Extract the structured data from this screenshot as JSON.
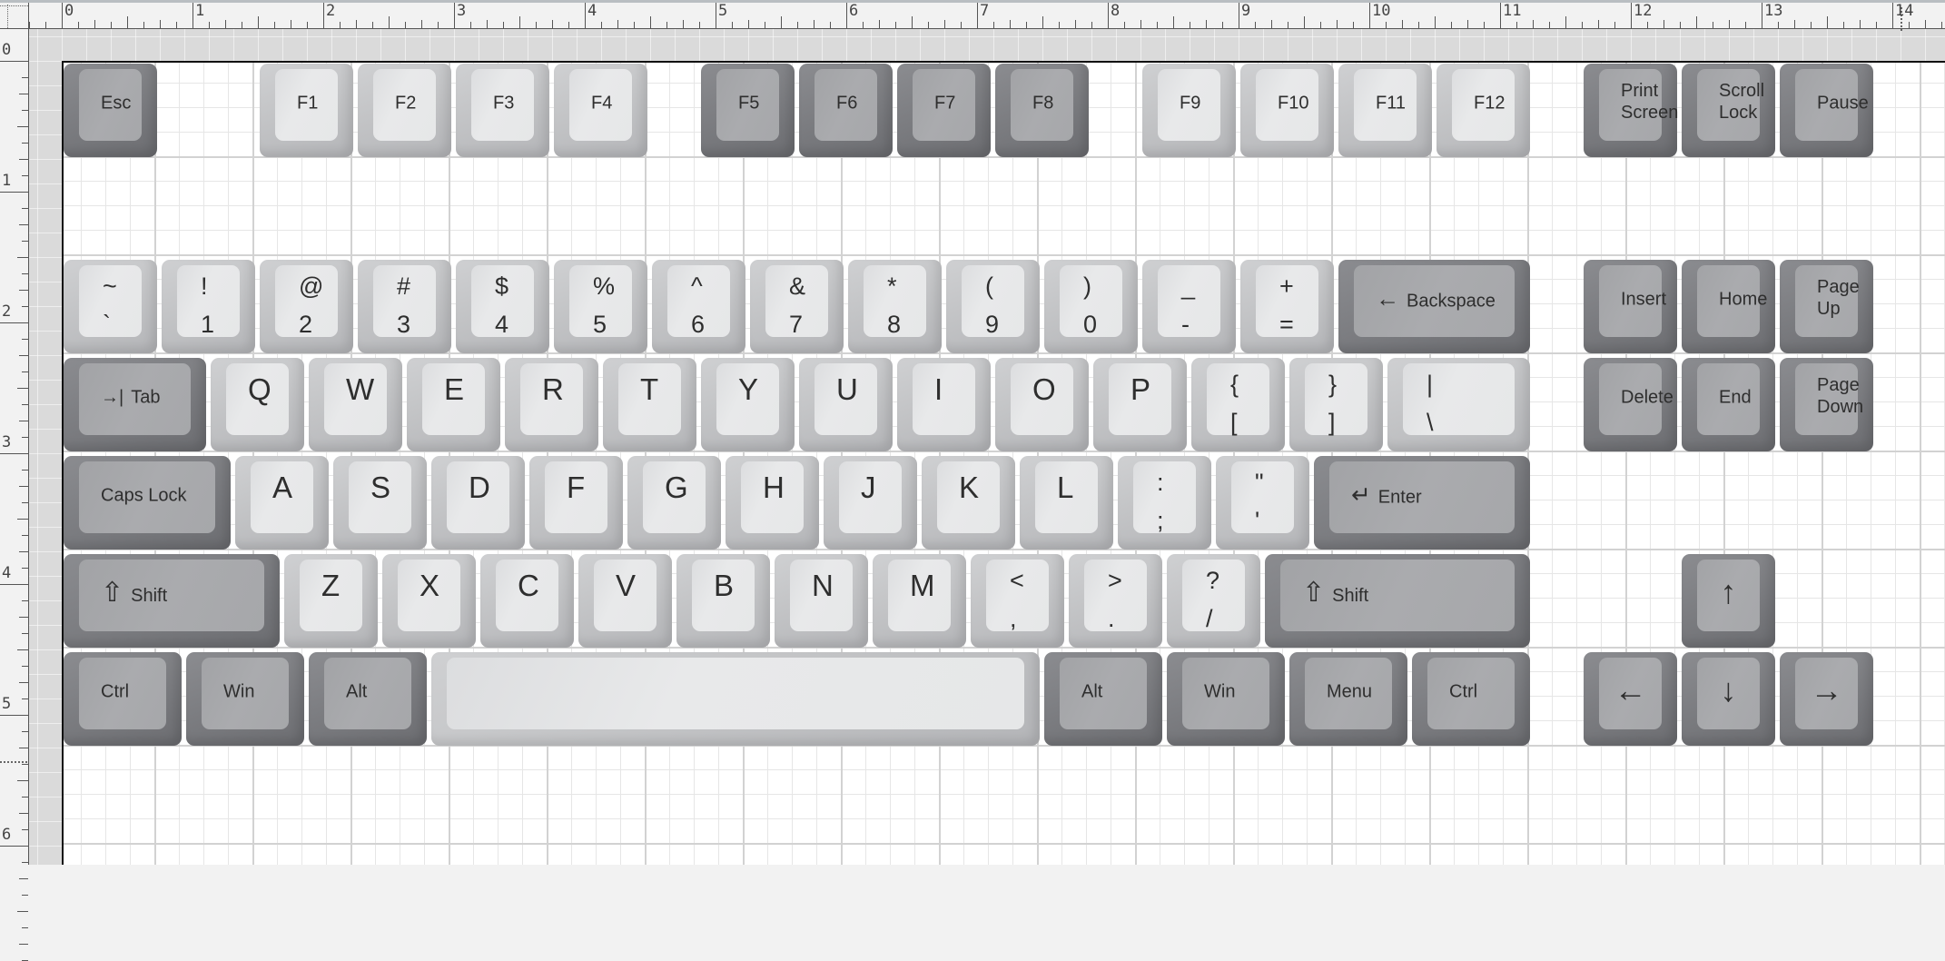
{
  "ruler": {
    "horizontal_labels": [
      "0",
      "1",
      "2",
      "3",
      "4",
      "5",
      "6",
      "7",
      "8",
      "9",
      "10",
      "11",
      "12",
      "13",
      "14"
    ],
    "vertical_labels": [
      "0",
      "1",
      "2",
      "3",
      "4",
      "5",
      "6"
    ]
  },
  "keyboard": {
    "keys": [
      {
        "id": "esc",
        "label": "Esc",
        "row": 0,
        "col": 0,
        "w": 1,
        "style": "dark",
        "type": "small"
      },
      {
        "id": "f1",
        "label": "F1",
        "row": 0,
        "col": 2,
        "w": 1,
        "style": "light",
        "type": "small"
      },
      {
        "id": "f2",
        "label": "F2",
        "row": 0,
        "col": 3,
        "w": 1,
        "style": "light",
        "type": "small"
      },
      {
        "id": "f3",
        "label": "F3",
        "row": 0,
        "col": 4,
        "w": 1,
        "style": "light",
        "type": "small"
      },
      {
        "id": "f4",
        "label": "F4",
        "row": 0,
        "col": 5,
        "w": 1,
        "style": "light",
        "type": "small"
      },
      {
        "id": "f5",
        "label": "F5",
        "row": 0,
        "col": 6.5,
        "w": 1,
        "style": "dark",
        "type": "small"
      },
      {
        "id": "f6",
        "label": "F6",
        "row": 0,
        "col": 7.5,
        "w": 1,
        "style": "dark",
        "type": "small"
      },
      {
        "id": "f7",
        "label": "F7",
        "row": 0,
        "col": 8.5,
        "w": 1,
        "style": "dark",
        "type": "small"
      },
      {
        "id": "f8",
        "label": "F8",
        "row": 0,
        "col": 9.5,
        "w": 1,
        "style": "dark",
        "type": "small"
      },
      {
        "id": "f9",
        "label": "F9",
        "row": 0,
        "col": 11,
        "w": 1,
        "style": "light",
        "type": "small"
      },
      {
        "id": "f10",
        "label": "F10",
        "row": 0,
        "col": 12,
        "w": 1,
        "style": "light",
        "type": "small"
      },
      {
        "id": "f11",
        "label": "F11",
        "row": 0,
        "col": 13,
        "w": 1,
        "style": "light",
        "type": "small"
      },
      {
        "id": "f12",
        "label": "F12",
        "row": 0,
        "col": 14,
        "w": 1,
        "style": "light",
        "type": "small"
      },
      {
        "id": "print-screen",
        "label": "Print\nScreen",
        "row": 0,
        "col": 15.5,
        "w": 1,
        "style": "dark",
        "type": "two"
      },
      {
        "id": "scroll-lock",
        "label": "Scroll\nLock",
        "row": 0,
        "col": 16.5,
        "w": 1,
        "style": "dark",
        "type": "two"
      },
      {
        "id": "pause",
        "label": "Pause",
        "row": 0,
        "col": 17.5,
        "w": 1,
        "style": "dark",
        "type": "small"
      },
      {
        "id": "grave",
        "shift": "~",
        "base": "`",
        "row": 2,
        "col": 0,
        "w": 1,
        "style": "light",
        "type": "sym"
      },
      {
        "id": "1",
        "shift": "!",
        "base": "1",
        "row": 2,
        "col": 1,
        "w": 1,
        "style": "light",
        "type": "sym"
      },
      {
        "id": "2",
        "shift": "@",
        "base": "2",
        "row": 2,
        "col": 2,
        "w": 1,
        "style": "light",
        "type": "sym"
      },
      {
        "id": "3",
        "shift": "#",
        "base": "3",
        "row": 2,
        "col": 3,
        "w": 1,
        "style": "light",
        "type": "sym"
      },
      {
        "id": "4",
        "shift": "$",
        "base": "4",
        "row": 2,
        "col": 4,
        "w": 1,
        "style": "light",
        "type": "sym"
      },
      {
        "id": "5",
        "shift": "%",
        "base": "5",
        "row": 2,
        "col": 5,
        "w": 1,
        "style": "light",
        "type": "sym"
      },
      {
        "id": "6",
        "shift": "^",
        "base": "6",
        "row": 2,
        "col": 6,
        "w": 1,
        "style": "light",
        "type": "sym"
      },
      {
        "id": "7",
        "shift": "&",
        "base": "7",
        "row": 2,
        "col": 7,
        "w": 1,
        "style": "light",
        "type": "sym"
      },
      {
        "id": "8",
        "shift": "*",
        "base": "8",
        "row": 2,
        "col": 8,
        "w": 1,
        "style": "light",
        "type": "sym"
      },
      {
        "id": "9",
        "shift": "(",
        "base": "9",
        "row": 2,
        "col": 9,
        "w": 1,
        "style": "light",
        "type": "sym"
      },
      {
        "id": "0",
        "shift": ")",
        "base": "0",
        "row": 2,
        "col": 10,
        "w": 1,
        "style": "light",
        "type": "sym"
      },
      {
        "id": "minus",
        "shift": "_",
        "base": "-",
        "row": 2,
        "col": 11,
        "w": 1,
        "style": "light",
        "type": "sym"
      },
      {
        "id": "equal",
        "shift": "+",
        "base": "=",
        "row": 2,
        "col": 12,
        "w": 1,
        "style": "light",
        "type": "sym"
      },
      {
        "id": "backspace",
        "label": "Backspace",
        "icon": "←",
        "row": 2,
        "col": 13,
        "w": 2,
        "style": "dark",
        "type": "small"
      },
      {
        "id": "insert",
        "label": "Insert",
        "row": 2,
        "col": 15.5,
        "w": 1,
        "style": "dark",
        "type": "small"
      },
      {
        "id": "home",
        "label": "Home",
        "row": 2,
        "col": 16.5,
        "w": 1,
        "style": "dark",
        "type": "small"
      },
      {
        "id": "page-up",
        "label": "Page\nUp",
        "row": 2,
        "col": 17.5,
        "w": 1,
        "style": "dark",
        "type": "two"
      },
      {
        "id": "tab",
        "label": "Tab",
        "icon": "→|",
        "row": 3,
        "col": 0,
        "w": 1.5,
        "style": "dark",
        "type": "small"
      },
      {
        "id": "q",
        "label": "Q",
        "row": 3,
        "col": 1.5,
        "w": 1,
        "style": "light",
        "type": "letter"
      },
      {
        "id": "w",
        "label": "W",
        "row": 3,
        "col": 2.5,
        "w": 1,
        "style": "light",
        "type": "letter"
      },
      {
        "id": "e",
        "label": "E",
        "row": 3,
        "col": 3.5,
        "w": 1,
        "style": "light",
        "type": "letter"
      },
      {
        "id": "r",
        "label": "R",
        "row": 3,
        "col": 4.5,
        "w": 1,
        "style": "light",
        "type": "letter"
      },
      {
        "id": "t",
        "label": "T",
        "row": 3,
        "col": 5.5,
        "w": 1,
        "style": "light",
        "type": "letter"
      },
      {
        "id": "y",
        "label": "Y",
        "row": 3,
        "col": 6.5,
        "w": 1,
        "style": "light",
        "type": "letter"
      },
      {
        "id": "u",
        "label": "U",
        "row": 3,
        "col": 7.5,
        "w": 1,
        "style": "light",
        "type": "letter"
      },
      {
        "id": "i",
        "label": "I",
        "row": 3,
        "col": 8.5,
        "w": 1,
        "style": "light",
        "type": "letter"
      },
      {
        "id": "o",
        "label": "O",
        "row": 3,
        "col": 9.5,
        "w": 1,
        "style": "light",
        "type": "letter"
      },
      {
        "id": "p",
        "label": "P",
        "row": 3,
        "col": 10.5,
        "w": 1,
        "style": "light",
        "type": "letter"
      },
      {
        "id": "lbracket",
        "shift": "{",
        "base": "[",
        "row": 3,
        "col": 11.5,
        "w": 1,
        "style": "light",
        "type": "sym"
      },
      {
        "id": "rbracket",
        "shift": "}",
        "base": "]",
        "row": 3,
        "col": 12.5,
        "w": 1,
        "style": "light",
        "type": "sym"
      },
      {
        "id": "backslash",
        "shift": "|",
        "base": "\\",
        "row": 3,
        "col": 13.5,
        "w": 1.5,
        "style": "light",
        "type": "sym"
      },
      {
        "id": "delete",
        "label": "Delete",
        "row": 3,
        "col": 15.5,
        "w": 1,
        "style": "dark",
        "type": "small"
      },
      {
        "id": "end",
        "label": "End",
        "row": 3,
        "col": 16.5,
        "w": 1,
        "style": "dark",
        "type": "small"
      },
      {
        "id": "page-down",
        "label": "Page\nDown",
        "row": 3,
        "col": 17.5,
        "w": 1,
        "style": "dark",
        "type": "two"
      },
      {
        "id": "caps-lock",
        "label": "Caps Lock",
        "row": 4,
        "col": 0,
        "w": 1.75,
        "style": "dark",
        "type": "small"
      },
      {
        "id": "a",
        "label": "A",
        "row": 4,
        "col": 1.75,
        "w": 1,
        "style": "light",
        "type": "letter"
      },
      {
        "id": "s",
        "label": "S",
        "row": 4,
        "col": 2.75,
        "w": 1,
        "style": "light",
        "type": "letter"
      },
      {
        "id": "d",
        "label": "D",
        "row": 4,
        "col": 3.75,
        "w": 1,
        "style": "light",
        "type": "letter"
      },
      {
        "id": "f",
        "label": "F",
        "row": 4,
        "col": 4.75,
        "w": 1,
        "style": "light",
        "type": "letter"
      },
      {
        "id": "g",
        "label": "G",
        "row": 4,
        "col": 5.75,
        "w": 1,
        "style": "light",
        "type": "letter"
      },
      {
        "id": "h",
        "label": "H",
        "row": 4,
        "col": 6.75,
        "w": 1,
        "style": "light",
        "type": "letter"
      },
      {
        "id": "j",
        "label": "J",
        "row": 4,
        "col": 7.75,
        "w": 1,
        "style": "light",
        "type": "letter"
      },
      {
        "id": "k",
        "label": "K",
        "row": 4,
        "col": 8.75,
        "w": 1,
        "style": "light",
        "type": "letter"
      },
      {
        "id": "l",
        "label": "L",
        "row": 4,
        "col": 9.75,
        "w": 1,
        "style": "light",
        "type": "letter"
      },
      {
        "id": "semicolon",
        "shift": ":",
        "base": ";",
        "row": 4,
        "col": 10.75,
        "w": 1,
        "style": "light",
        "type": "sym"
      },
      {
        "id": "quote",
        "shift": "\"",
        "base": "'",
        "row": 4,
        "col": 11.75,
        "w": 1,
        "style": "light",
        "type": "sym"
      },
      {
        "id": "enter",
        "label": "Enter",
        "icon": "↵",
        "row": 4,
        "col": 12.75,
        "w": 2.25,
        "style": "dark",
        "type": "small"
      },
      {
        "id": "left-shift",
        "label": "Shift",
        "icon": "⇧",
        "row": 5,
        "col": 0,
        "w": 2.25,
        "style": "dark",
        "type": "small"
      },
      {
        "id": "z",
        "label": "Z",
        "row": 5,
        "col": 2.25,
        "w": 1,
        "style": "light",
        "type": "letter"
      },
      {
        "id": "x",
        "label": "X",
        "row": 5,
        "col": 3.25,
        "w": 1,
        "style": "light",
        "type": "letter"
      },
      {
        "id": "c",
        "label": "C",
        "row": 5,
        "col": 4.25,
        "w": 1,
        "style": "light",
        "type": "letter"
      },
      {
        "id": "v",
        "label": "V",
        "row": 5,
        "col": 5.25,
        "w": 1,
        "style": "light",
        "type": "letter"
      },
      {
        "id": "b",
        "label": "B",
        "row": 5,
        "col": 6.25,
        "w": 1,
        "style": "light",
        "type": "letter"
      },
      {
        "id": "n",
        "label": "N",
        "row": 5,
        "col": 7.25,
        "w": 1,
        "style": "light",
        "type": "letter"
      },
      {
        "id": "m",
        "label": "M",
        "row": 5,
        "col": 8.25,
        "w": 1,
        "style": "light",
        "type": "letter"
      },
      {
        "id": "comma",
        "shift": "<",
        "base": ",",
        "row": 5,
        "col": 9.25,
        "w": 1,
        "style": "light",
        "type": "sym"
      },
      {
        "id": "period",
        "shift": ">",
        "base": ".",
        "row": 5,
        "col": 10.25,
        "w": 1,
        "style": "light",
        "type": "sym"
      },
      {
        "id": "slash",
        "shift": "?",
        "base": "/",
        "row": 5,
        "col": 11.25,
        "w": 1,
        "style": "light",
        "type": "sym"
      },
      {
        "id": "right-shift",
        "label": "Shift",
        "icon": "⇧",
        "row": 5,
        "col": 12.25,
        "w": 2.75,
        "style": "dark",
        "type": "small"
      },
      {
        "id": "arrow-up",
        "label": "↑",
        "row": 5,
        "col": 16.5,
        "w": 1,
        "style": "dark",
        "type": "arrow"
      },
      {
        "id": "left-ctrl",
        "label": "Ctrl",
        "row": 6,
        "col": 0,
        "w": 1.25,
        "style": "dark",
        "type": "small"
      },
      {
        "id": "left-win",
        "label": "Win",
        "row": 6,
        "col": 1.25,
        "w": 1.25,
        "style": "dark",
        "type": "small"
      },
      {
        "id": "left-alt",
        "label": "Alt",
        "row": 6,
        "col": 2.5,
        "w": 1.25,
        "style": "dark",
        "type": "small"
      },
      {
        "id": "space",
        "label": "",
        "row": 6,
        "col": 3.75,
        "w": 6.25,
        "style": "light",
        "type": "small"
      },
      {
        "id": "right-alt",
        "label": "Alt",
        "row": 6,
        "col": 10,
        "w": 1.25,
        "style": "dark",
        "type": "small"
      },
      {
        "id": "right-win",
        "label": "Win",
        "row": 6,
        "col": 11.25,
        "w": 1.25,
        "style": "dark",
        "type": "small"
      },
      {
        "id": "menu",
        "label": "Menu",
        "row": 6,
        "col": 12.5,
        "w": 1.25,
        "style": "dark",
        "type": "small"
      },
      {
        "id": "right-ctrl",
        "label": "Ctrl",
        "row": 6,
        "col": 13.75,
        "w": 1.25,
        "style": "dark",
        "type": "small"
      },
      {
        "id": "arrow-left",
        "label": "←",
        "row": 6,
        "col": 15.5,
        "w": 1,
        "style": "dark",
        "type": "arrow"
      },
      {
        "id": "arrow-down",
        "label": "↓",
        "row": 6,
        "col": 16.5,
        "w": 1,
        "style": "dark",
        "type": "arrow"
      },
      {
        "id": "arrow-right",
        "label": "→",
        "row": 6,
        "col": 17.5,
        "w": 1,
        "style": "dark",
        "type": "arrow"
      }
    ]
  }
}
